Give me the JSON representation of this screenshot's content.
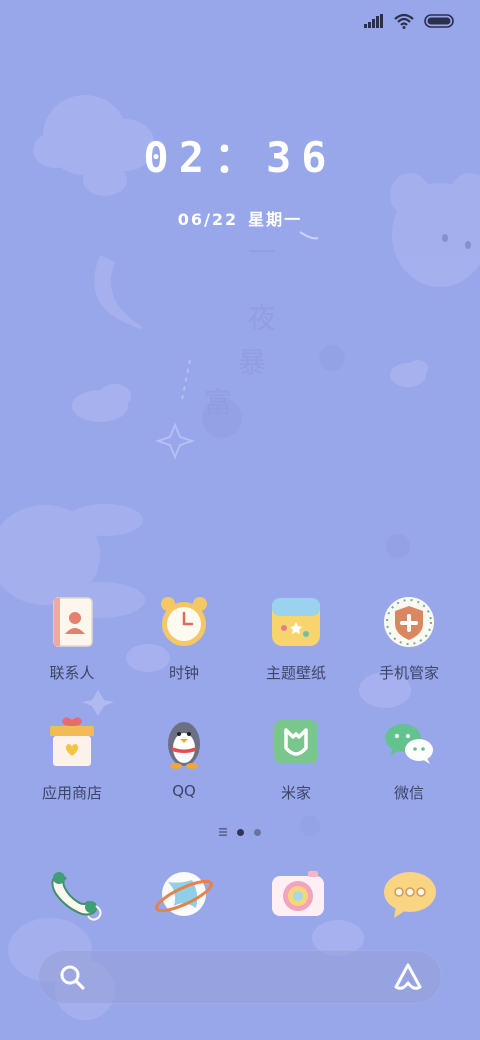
{
  "lockscreen": {
    "time": "02：36",
    "date": {
      "day": "06/22",
      "weekday": "星期一"
    }
  },
  "apps": [
    {
      "label": "联系人",
      "icon": "contacts-icon"
    },
    {
      "label": "时钟",
      "icon": "alarm-clock-icon"
    },
    {
      "label": "主题壁纸",
      "icon": "theme-wallpaper-icon"
    },
    {
      "label": "手机管家",
      "icon": "security-shield-icon"
    },
    {
      "label": "应用商店",
      "icon": "app-store-gift-icon"
    },
    {
      "label": "QQ",
      "icon": "qq-penguin-icon"
    },
    {
      "label": "米家",
      "icon": "mijia-icon"
    },
    {
      "label": "微信",
      "icon": "wechat-icon"
    }
  ],
  "page_indicator": {
    "pages": 2,
    "current": 1
  },
  "dock": [
    {
      "icon": "phone-icon"
    },
    {
      "icon": "browser-planet-icon"
    },
    {
      "icon": "camera-icon"
    },
    {
      "icon": "messages-icon"
    }
  ],
  "wallpaper_text": [
    "一",
    "夜",
    "暴",
    "富"
  ],
  "colors": {
    "background": "#98a7ea",
    "label": "#3e4566",
    "text_light": "#ffffff"
  }
}
